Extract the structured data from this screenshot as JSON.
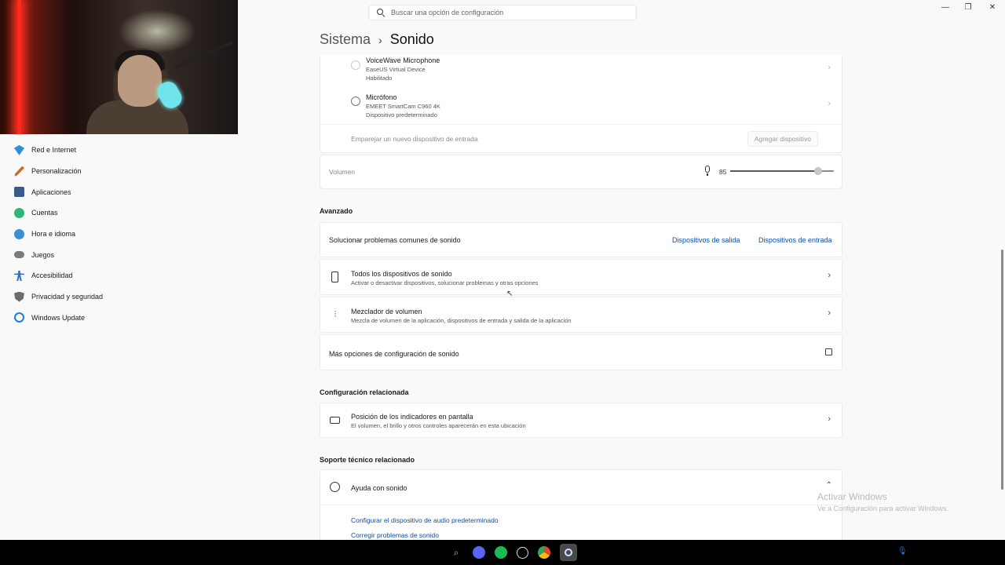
{
  "search": {
    "placeholder": "Buscar una opción de configuración"
  },
  "window_controls": {
    "minimize": "—",
    "maximize": "❐",
    "close": "✕"
  },
  "breadcrumb": {
    "parent": "Sistema",
    "separator": "›",
    "current": "Sonido"
  },
  "sidebar": {
    "items": [
      {
        "label": "Red e Internet",
        "icon": "wifi-icon",
        "color": "#2c8fd8"
      },
      {
        "label": "Personalización",
        "icon": "brush-icon",
        "color": "#c46a2c"
      },
      {
        "label": "Aplicaciones",
        "icon": "apps-icon",
        "color": "#385b8a"
      },
      {
        "label": "Cuentas",
        "icon": "account-icon",
        "color": "#2fb47d"
      },
      {
        "label": "Hora e idioma",
        "icon": "globe-clock-icon",
        "color": "#3a8fd0"
      },
      {
        "label": "Juegos",
        "icon": "gamepad-icon",
        "color": "#7a7a7a"
      },
      {
        "label": "Accesibilidad",
        "icon": "accessibility-icon",
        "color": "#2a6fd0"
      },
      {
        "label": "Privacidad y seguridad",
        "icon": "shield-icon",
        "color": "#6d6d6d"
      },
      {
        "label": "Windows Update",
        "icon": "update-icon",
        "color": "#1f7fd6"
      }
    ]
  },
  "input_devices": [
    {
      "name": "VoiceWave Microphone",
      "device": "EaseUS Virtual Device",
      "status": "Habilitado"
    },
    {
      "name": "Micrófono",
      "device": "EMEET SmartCam C960 4K",
      "status": "Dispositivo predeterminado"
    }
  ],
  "pair_new": {
    "label": "Emparejar un nuevo dispositivo de entrada",
    "button": "Agregar dispositivo"
  },
  "volume": {
    "label": "Volumen",
    "value": "85",
    "level": 0.85
  },
  "advanced": {
    "heading": "Avanzado",
    "troubleshoot": {
      "label": "Solucionar problemas comunes de sonido",
      "output_link": "Dispositivos de salida",
      "input_link": "Dispositivos de entrada"
    },
    "all_devices": {
      "title": "Todos los dispositivos de sonido",
      "subtitle": "Activar o desactivar dispositivos, solucionar problemas y otras opciones"
    },
    "mixer": {
      "title": "Mezclador de volumen",
      "subtitle": "Mezcla de volumen de la aplicación, dispositivos de entrada y salida de la aplicación"
    },
    "more": {
      "title": "Más opciones de configuración de sonido"
    }
  },
  "related_config": {
    "heading": "Configuración relacionada",
    "indicators": {
      "title": "Posición de los indicadores en pantalla",
      "subtitle": "El volumen, el brillo y otros controles aparecerán en esta ubicación"
    }
  },
  "support": {
    "heading": "Soporte técnico relacionado",
    "help": {
      "title": "Ayuda con sonido"
    },
    "links": [
      "Configurar el dispositivo de audio predeterminado",
      "Corregir problemas de sonido"
    ]
  },
  "watermark": {
    "title": "Activar Windows",
    "subtitle": "Ve a Configuración para activar Windows."
  }
}
